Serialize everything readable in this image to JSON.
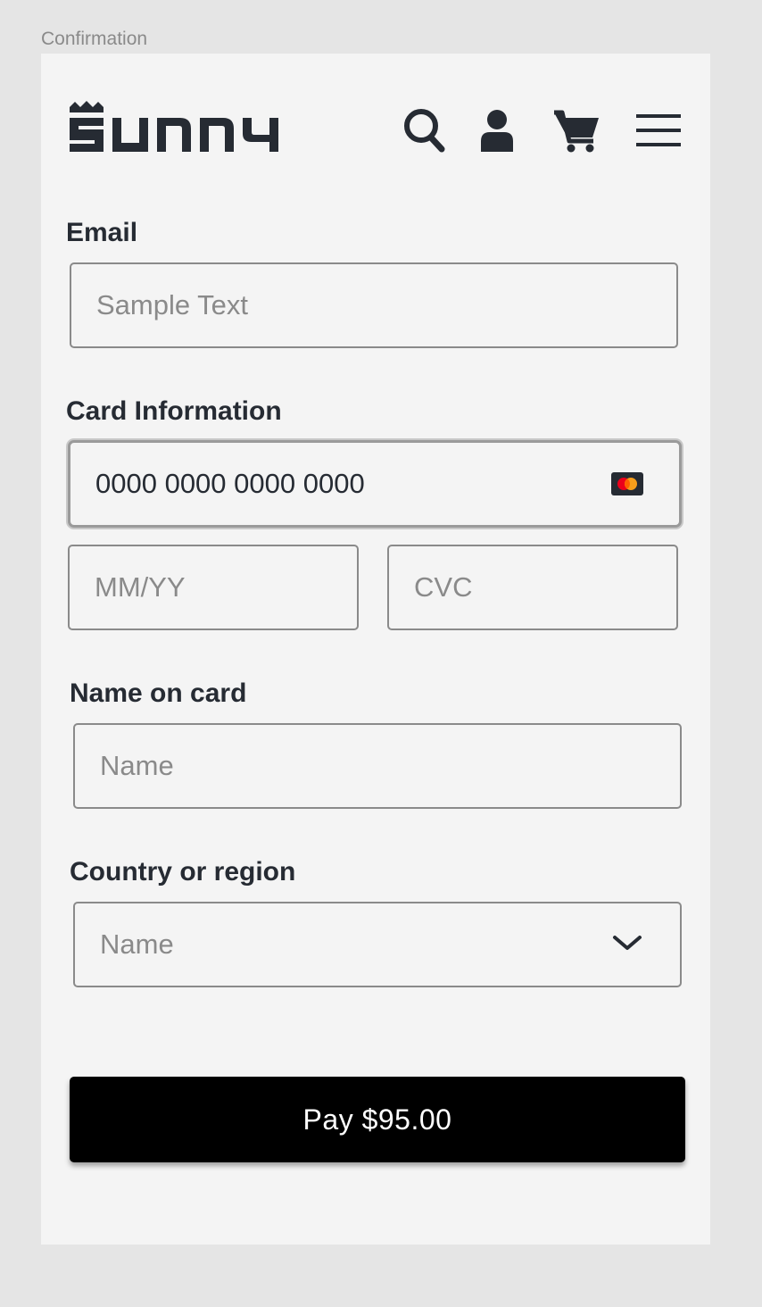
{
  "frame": {
    "label": "Confirmation"
  },
  "header": {
    "logo_text": "SUNNY",
    "icons": [
      "search-icon",
      "user-icon",
      "cart-icon",
      "menu-icon"
    ]
  },
  "form": {
    "email": {
      "label": "Email",
      "placeholder": "Sample Text"
    },
    "card": {
      "label": "Card Information",
      "number_value": "0000 0000 0000 0000",
      "brand_icon": "mastercard-icon",
      "expiry_placeholder": "MM/YY",
      "cvc_placeholder": "CVC"
    },
    "name": {
      "label": "Name on card",
      "placeholder": "Name"
    },
    "country": {
      "label": "Country or region",
      "placeholder": "Name"
    }
  },
  "pay_button": {
    "label": "Pay $95.00"
  },
  "colors": {
    "background": "#e5e5e5",
    "frame": "#f4f4f4",
    "text": "#262b33",
    "placeholder": "#8a8a8a",
    "button": "#000000",
    "mastercard_red": "#eb001b",
    "mastercard_orange": "#f79e1b"
  }
}
